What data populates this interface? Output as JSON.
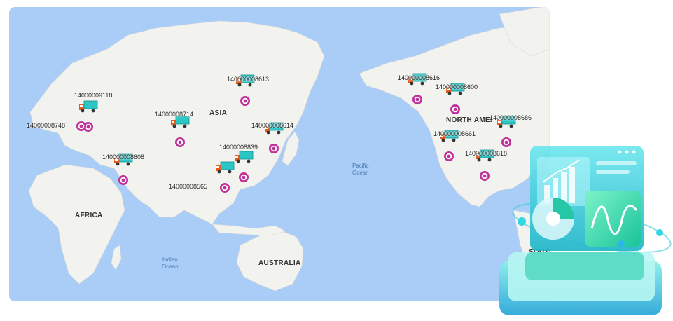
{
  "map": {
    "regions": {
      "asia": "ASIA",
      "africa": "AFRICA",
      "australia": "AUSTRALIA",
      "north_america": "NORTH AMEI",
      "south_america": "SOUTI"
    },
    "oceans": {
      "pacific_line1": "Pacific",
      "pacific_line2": "Ocean",
      "indian_line1": "Indian",
      "indian_line2": "Ocean"
    },
    "vehicles": [
      {
        "id": "14000009118"
      },
      {
        "id": "14000008748"
      },
      {
        "id": "140000008613"
      },
      {
        "id": "14000008714"
      },
      {
        "id": "140000008614"
      },
      {
        "id": "14000008839"
      },
      {
        "id": "140000008608"
      },
      {
        "id": "14000008565"
      },
      {
        "id": "140000008616"
      },
      {
        "id": "140000008600"
      },
      {
        "id": "140000008686"
      },
      {
        "id": "140000008661"
      },
      {
        "id": "140000008618"
      }
    ],
    "colors": {
      "water": "#a9cdf6",
      "land": "#f2f2ef",
      "truck_body": "#2cc6c6",
      "truck_cab": "#e45a1c",
      "pin": "#c0309a"
    },
    "icons": {
      "truck": "delivery-truck-icon",
      "pin": "location-pin-icon"
    }
  },
  "decoration": {
    "icon": "analytics-dashboard-illustration"
  }
}
